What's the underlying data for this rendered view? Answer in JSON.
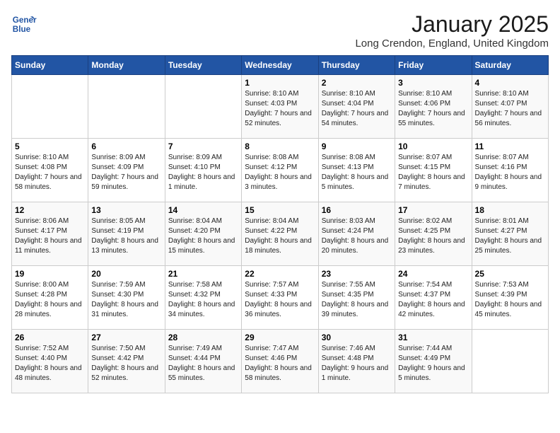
{
  "logo": {
    "line1": "General",
    "line2": "Blue"
  },
  "title": "January 2025",
  "location": "Long Crendon, England, United Kingdom",
  "days_header": [
    "Sunday",
    "Monday",
    "Tuesday",
    "Wednesday",
    "Thursday",
    "Friday",
    "Saturday"
  ],
  "weeks": [
    [
      {
        "day": "",
        "info": ""
      },
      {
        "day": "",
        "info": ""
      },
      {
        "day": "",
        "info": ""
      },
      {
        "day": "1",
        "info": "Sunrise: 8:10 AM\nSunset: 4:03 PM\nDaylight: 7 hours and 52 minutes."
      },
      {
        "day": "2",
        "info": "Sunrise: 8:10 AM\nSunset: 4:04 PM\nDaylight: 7 hours and 54 minutes."
      },
      {
        "day": "3",
        "info": "Sunrise: 8:10 AM\nSunset: 4:06 PM\nDaylight: 7 hours and 55 minutes."
      },
      {
        "day": "4",
        "info": "Sunrise: 8:10 AM\nSunset: 4:07 PM\nDaylight: 7 hours and 56 minutes."
      }
    ],
    [
      {
        "day": "5",
        "info": "Sunrise: 8:10 AM\nSunset: 4:08 PM\nDaylight: 7 hours and 58 minutes."
      },
      {
        "day": "6",
        "info": "Sunrise: 8:09 AM\nSunset: 4:09 PM\nDaylight: 7 hours and 59 minutes."
      },
      {
        "day": "7",
        "info": "Sunrise: 8:09 AM\nSunset: 4:10 PM\nDaylight: 8 hours and 1 minute."
      },
      {
        "day": "8",
        "info": "Sunrise: 8:08 AM\nSunset: 4:12 PM\nDaylight: 8 hours and 3 minutes."
      },
      {
        "day": "9",
        "info": "Sunrise: 8:08 AM\nSunset: 4:13 PM\nDaylight: 8 hours and 5 minutes."
      },
      {
        "day": "10",
        "info": "Sunrise: 8:07 AM\nSunset: 4:15 PM\nDaylight: 8 hours and 7 minutes."
      },
      {
        "day": "11",
        "info": "Sunrise: 8:07 AM\nSunset: 4:16 PM\nDaylight: 8 hours and 9 minutes."
      }
    ],
    [
      {
        "day": "12",
        "info": "Sunrise: 8:06 AM\nSunset: 4:17 PM\nDaylight: 8 hours and 11 minutes."
      },
      {
        "day": "13",
        "info": "Sunrise: 8:05 AM\nSunset: 4:19 PM\nDaylight: 8 hours and 13 minutes."
      },
      {
        "day": "14",
        "info": "Sunrise: 8:04 AM\nSunset: 4:20 PM\nDaylight: 8 hours and 15 minutes."
      },
      {
        "day": "15",
        "info": "Sunrise: 8:04 AM\nSunset: 4:22 PM\nDaylight: 8 hours and 18 minutes."
      },
      {
        "day": "16",
        "info": "Sunrise: 8:03 AM\nSunset: 4:24 PM\nDaylight: 8 hours and 20 minutes."
      },
      {
        "day": "17",
        "info": "Sunrise: 8:02 AM\nSunset: 4:25 PM\nDaylight: 8 hours and 23 minutes."
      },
      {
        "day": "18",
        "info": "Sunrise: 8:01 AM\nSunset: 4:27 PM\nDaylight: 8 hours and 25 minutes."
      }
    ],
    [
      {
        "day": "19",
        "info": "Sunrise: 8:00 AM\nSunset: 4:28 PM\nDaylight: 8 hours and 28 minutes."
      },
      {
        "day": "20",
        "info": "Sunrise: 7:59 AM\nSunset: 4:30 PM\nDaylight: 8 hours and 31 minutes."
      },
      {
        "day": "21",
        "info": "Sunrise: 7:58 AM\nSunset: 4:32 PM\nDaylight: 8 hours and 34 minutes."
      },
      {
        "day": "22",
        "info": "Sunrise: 7:57 AM\nSunset: 4:33 PM\nDaylight: 8 hours and 36 minutes."
      },
      {
        "day": "23",
        "info": "Sunrise: 7:55 AM\nSunset: 4:35 PM\nDaylight: 8 hours and 39 minutes."
      },
      {
        "day": "24",
        "info": "Sunrise: 7:54 AM\nSunset: 4:37 PM\nDaylight: 8 hours and 42 minutes."
      },
      {
        "day": "25",
        "info": "Sunrise: 7:53 AM\nSunset: 4:39 PM\nDaylight: 8 hours and 45 minutes."
      }
    ],
    [
      {
        "day": "26",
        "info": "Sunrise: 7:52 AM\nSunset: 4:40 PM\nDaylight: 8 hours and 48 minutes."
      },
      {
        "day": "27",
        "info": "Sunrise: 7:50 AM\nSunset: 4:42 PM\nDaylight: 8 hours and 52 minutes."
      },
      {
        "day": "28",
        "info": "Sunrise: 7:49 AM\nSunset: 4:44 PM\nDaylight: 8 hours and 55 minutes."
      },
      {
        "day": "29",
        "info": "Sunrise: 7:47 AM\nSunset: 4:46 PM\nDaylight: 8 hours and 58 minutes."
      },
      {
        "day": "30",
        "info": "Sunrise: 7:46 AM\nSunset: 4:48 PM\nDaylight: 9 hours and 1 minute."
      },
      {
        "day": "31",
        "info": "Sunrise: 7:44 AM\nSunset: 4:49 PM\nDaylight: 9 hours and 5 minutes."
      },
      {
        "day": "",
        "info": ""
      }
    ]
  ]
}
